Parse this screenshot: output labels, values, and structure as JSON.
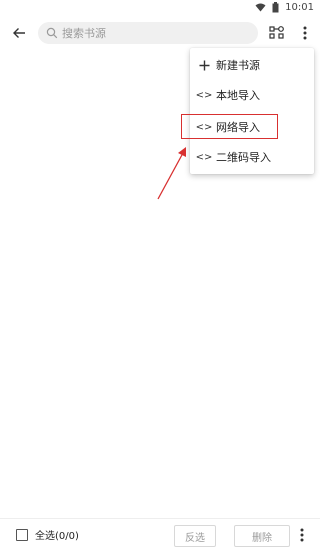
{
  "status_bar": {
    "time": "10:01",
    "icons": [
      "wifi-icon",
      "battery-icon"
    ]
  },
  "toolbar": {
    "back_icon": "arrow-left-icon",
    "search": {
      "placeholder": "搜索书源",
      "value": ""
    },
    "group_icon": "group-icon",
    "more_icon": "more-vertical-icon"
  },
  "menu": {
    "items": [
      {
        "label": "新建书源",
        "icon": "plus-icon"
      },
      {
        "label": "本地导入",
        "icon": "code-icon"
      },
      {
        "label": "网络导入",
        "icon": "code-icon"
      },
      {
        "label": "二维码导入",
        "icon": "code-icon"
      }
    ],
    "highlighted_index": 2
  },
  "annotation": {
    "highlight_color": "#d83030"
  },
  "bottom_bar": {
    "select_all_label": "全选(0/0)",
    "invert_label": "反选",
    "delete_label": "删除",
    "more_icon": "more-vertical-icon"
  }
}
